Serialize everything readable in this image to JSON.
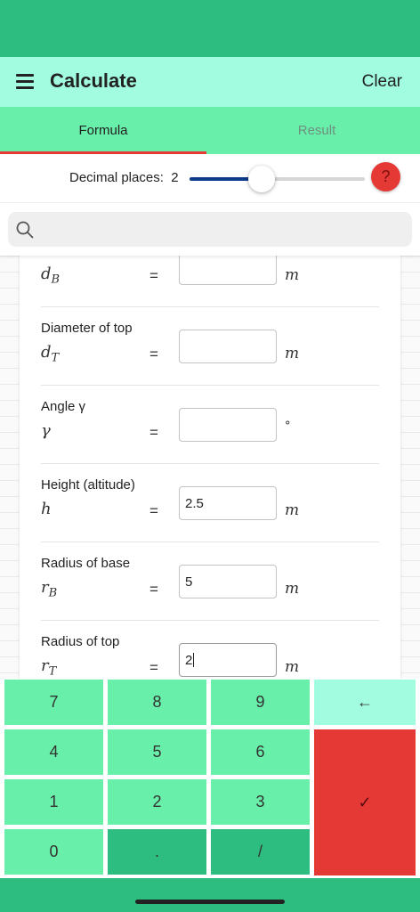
{
  "app": {
    "title": "Calculate",
    "clear_label": "Clear"
  },
  "tabs": [
    {
      "label": "Formula",
      "active": true
    },
    {
      "label": "Result",
      "active": false
    }
  ],
  "decimal": {
    "label": "Decimal places:",
    "value": "2",
    "slider_fraction": 0.41
  },
  "help": {
    "label": "?"
  },
  "search": {
    "value": "",
    "placeholder": ""
  },
  "rows": [
    {
      "label": "",
      "symbol": "d",
      "subscript": "B",
      "eq": "=",
      "value": "",
      "unit": "m"
    },
    {
      "label": "Diameter of top",
      "symbol": "d",
      "subscript": "T",
      "eq": "=",
      "value": "",
      "unit": "m"
    },
    {
      "label": "Angle γ",
      "symbol": "γ",
      "subscript": "",
      "eq": "=",
      "value": "",
      "unit": "°"
    },
    {
      "label": "Height (altitude)",
      "symbol": "h",
      "subscript": "",
      "eq": "=",
      "value": "2.5",
      "unit": "m"
    },
    {
      "label": "Radius of base",
      "symbol": "r",
      "subscript": "B",
      "eq": "=",
      "value": "5",
      "unit": "m"
    },
    {
      "label": "Radius of top",
      "symbol": "r",
      "subscript": "T",
      "eq": "=",
      "value": "2",
      "unit": "m"
    }
  ],
  "keypad": {
    "k7": "7",
    "k8": "8",
    "k9": "9",
    "back": "←",
    "k4": "4",
    "k5": "5",
    "k6": "6",
    "k1": "1",
    "k2": "2",
    "k3": "3",
    "k0": "0",
    "dot": ".",
    "slash": "/",
    "ok": "✓"
  },
  "colors": {
    "status": "#2ebd81",
    "appbar": "#a2fde0",
    "tabs": "#68efa9",
    "accent": "#e53935",
    "slider": "#0d3a8a"
  }
}
